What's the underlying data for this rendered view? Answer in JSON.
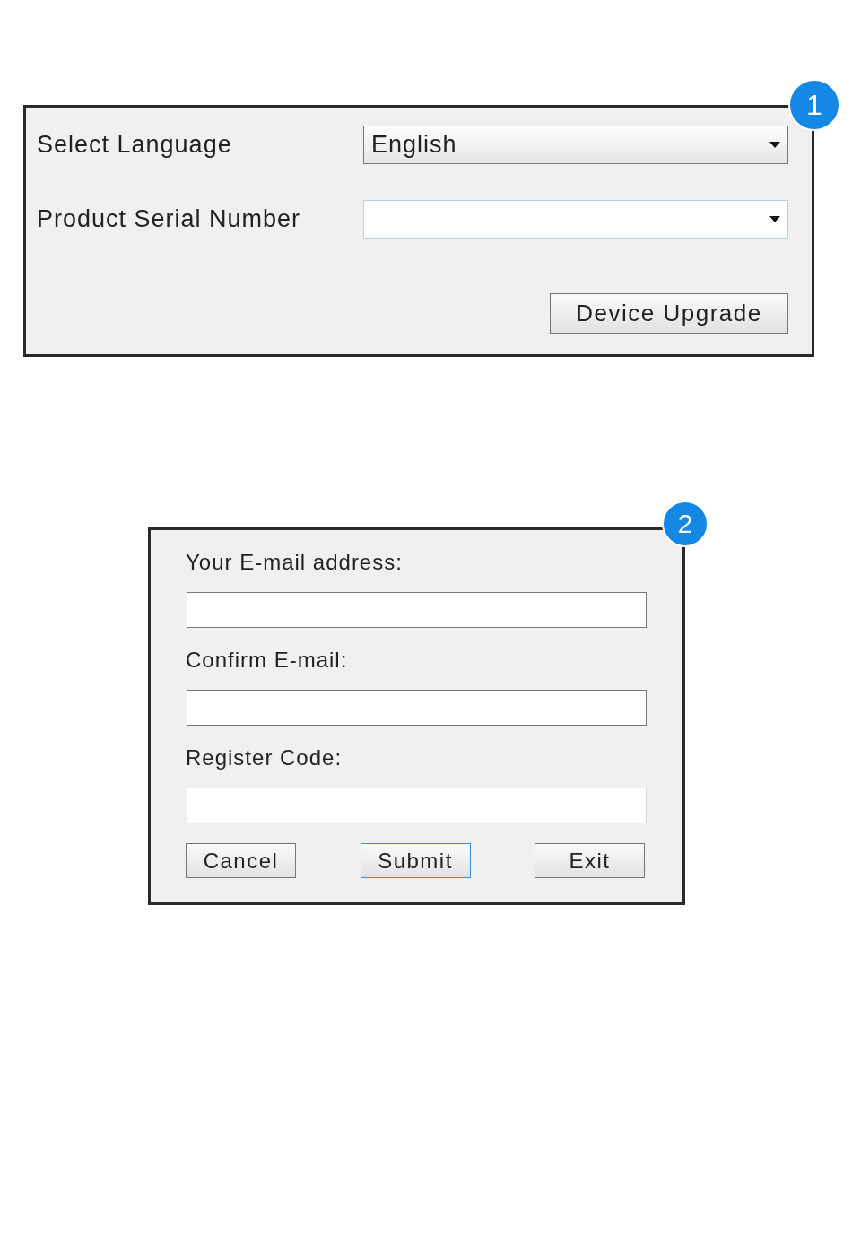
{
  "upgrade_dialog": {
    "badge": "1",
    "language": {
      "label": "Select Language",
      "value": "English"
    },
    "serial": {
      "label": "Product Serial Number"
    },
    "button": {
      "label": "Device Upgrade"
    }
  },
  "register_dialog": {
    "badge": "2",
    "fields": [
      {
        "label": "Your E-mail address:",
        "kind": "normal"
      },
      {
        "label": "Confirm E-mail:",
        "kind": "normal"
      },
      {
        "label": "Register Code:",
        "kind": "light"
      }
    ],
    "buttons": [
      {
        "label": "Cancel",
        "focused": false
      },
      {
        "label": "Submit",
        "focused": true
      },
      {
        "label": "Exit",
        "focused": false
      }
    ]
  }
}
